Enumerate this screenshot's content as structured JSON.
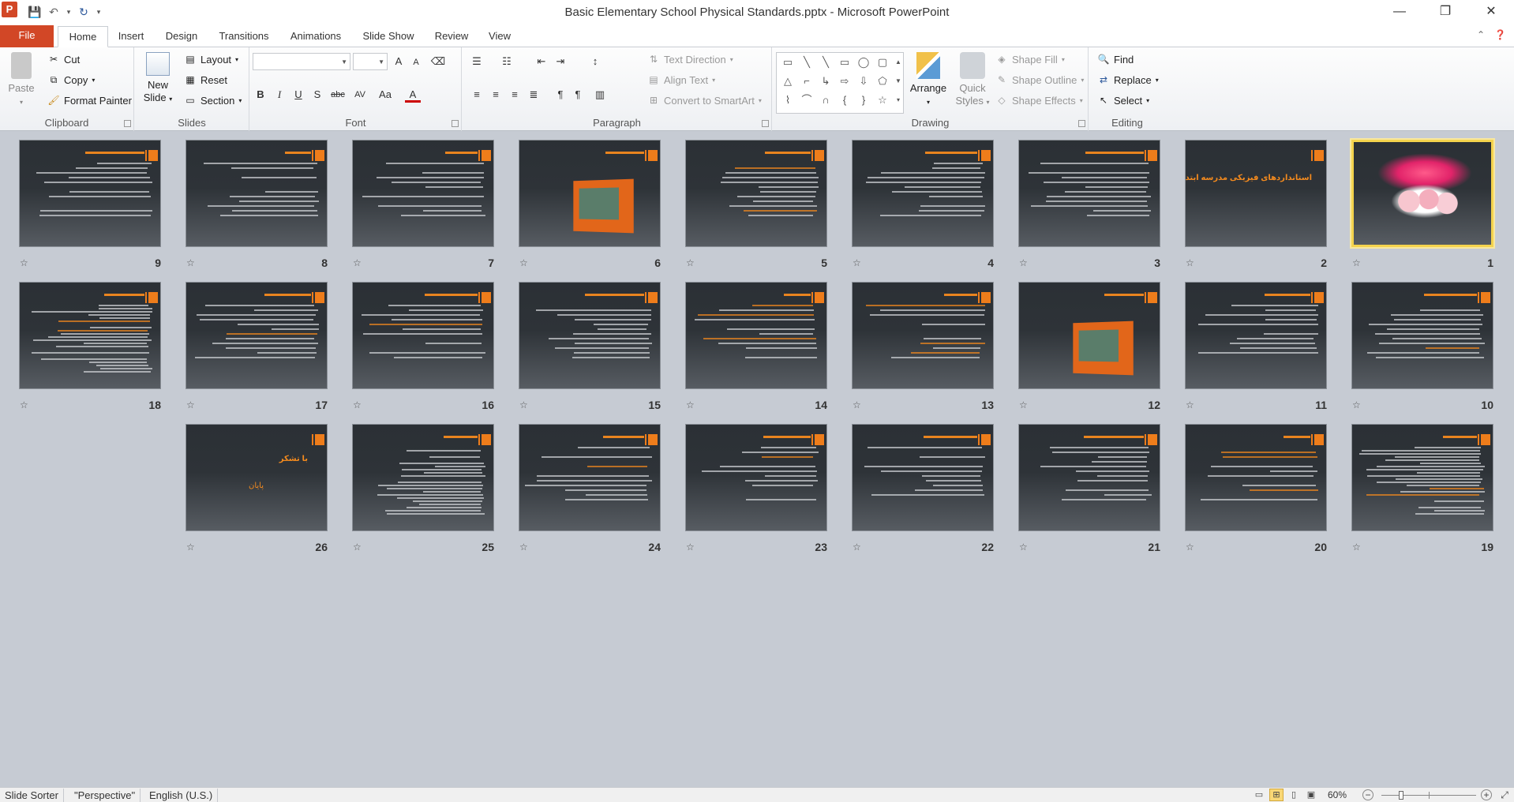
{
  "window": {
    "app_letter": "P",
    "title": "Basic Elementary School Physical Standards.pptx  -  Microsoft PowerPoint",
    "minimize": "—",
    "restore": "❐",
    "close": "✕"
  },
  "tabs": [
    "File",
    "Home",
    "Insert",
    "Design",
    "Transitions",
    "Animations",
    "Slide Show",
    "Review",
    "View"
  ],
  "active_tab": "Home",
  "clipboard": {
    "paste": "Paste",
    "cut": "Cut",
    "copy": "Copy",
    "format_painter": "Format Painter",
    "label": "Clipboard"
  },
  "slides_group": {
    "new_slide_line1": "New",
    "new_slide_line2": "Slide",
    "layout": "Layout",
    "reset": "Reset",
    "section": "Section",
    "label": "Slides"
  },
  "font_group": {
    "font_name": "",
    "font_size": "",
    "bold": "B",
    "italic": "I",
    "underline": "U",
    "shadow": "S",
    "strike": "abc",
    "spacing": "AV",
    "case": "Aa",
    "color": "A",
    "grow": "A",
    "shrink": "A",
    "label": "Font"
  },
  "paragraph_group": {
    "text_direction": "Text Direction",
    "align_text": "Align Text",
    "convert_smartart": "Convert to SmartArt",
    "label": "Paragraph"
  },
  "drawing_group": {
    "arrange": "Arrange",
    "quick_styles_line1": "Quick",
    "quick_styles_line2": "Styles",
    "shape_fill": "Shape Fill",
    "shape_outline": "Shape Outline",
    "shape_effects": "Shape Effects",
    "label": "Drawing"
  },
  "editing_group": {
    "find": "Find",
    "replace": "Replace",
    "select": "Select",
    "label": "Editing"
  },
  "slides": [
    {
      "num": "1",
      "kind": "calligraphy",
      "title": ""
    },
    {
      "num": "2",
      "kind": "title",
      "title": "استانداردهای فیزیکی مدرسه ابتدایی"
    },
    {
      "num": "3",
      "kind": "text",
      "title": ""
    },
    {
      "num": "4",
      "kind": "text",
      "title": ""
    },
    {
      "num": "5",
      "kind": "text",
      "title": ""
    },
    {
      "num": "6",
      "kind": "picture",
      "title": ""
    },
    {
      "num": "7",
      "kind": "text",
      "title": ""
    },
    {
      "num": "8",
      "kind": "text",
      "title": ""
    },
    {
      "num": "9",
      "kind": "text",
      "title": ""
    },
    {
      "num": "10",
      "kind": "text",
      "title": ""
    },
    {
      "num": "11",
      "kind": "text",
      "title": ""
    },
    {
      "num": "12",
      "kind": "picture",
      "title": ""
    },
    {
      "num": "13",
      "kind": "text",
      "title": ""
    },
    {
      "num": "14",
      "kind": "text",
      "title": ""
    },
    {
      "num": "15",
      "kind": "text",
      "title": ""
    },
    {
      "num": "16",
      "kind": "text",
      "title": ""
    },
    {
      "num": "17",
      "kind": "text",
      "title": ""
    },
    {
      "num": "18",
      "kind": "dense",
      "title": ""
    },
    {
      "num": "19",
      "kind": "dense",
      "title": ""
    },
    {
      "num": "20",
      "kind": "text",
      "title": ""
    },
    {
      "num": "21",
      "kind": "text",
      "title": ""
    },
    {
      "num": "22",
      "kind": "text",
      "title": ""
    },
    {
      "num": "23",
      "kind": "text",
      "title": ""
    },
    {
      "num": "24",
      "kind": "text",
      "title": ""
    },
    {
      "num": "25",
      "kind": "dense",
      "title": ""
    },
    {
      "num": "26",
      "kind": "end",
      "title": "با تشکر",
      "subtitle": "پایان"
    }
  ],
  "selected_slide": "1",
  "status": {
    "view": "Slide Sorter",
    "theme": "\"Perspective\"",
    "language": "English (U.S.)",
    "zoom": "60%"
  },
  "colors": {
    "accent_orange": "#ee7d1b",
    "file_tab": "#d24726",
    "selection": "#f4d34d"
  }
}
